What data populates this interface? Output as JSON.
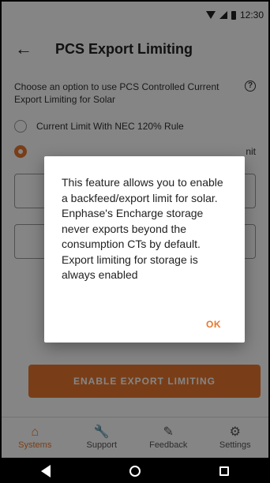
{
  "status": {
    "time": "12:30"
  },
  "appbar": {
    "title": "PCS Export Limiting"
  },
  "content": {
    "prompt": "Choose an option to use PCS Controlled Current Export Limiting for Solar",
    "options": [
      {
        "label": "Current Limit With NEC 120% Rule",
        "selected": false
      },
      {
        "label": "nit",
        "selected": true
      }
    ]
  },
  "primary_button": {
    "label": "ENABLE EXPORT LIMITING"
  },
  "nav": {
    "items": [
      {
        "label": "Systems",
        "icon": "home-icon",
        "active": true
      },
      {
        "label": "Support",
        "icon": "wrench-icon",
        "active": false
      },
      {
        "label": "Feedback",
        "icon": "feedback-icon",
        "active": false
      },
      {
        "label": "Settings",
        "icon": "gear-icon",
        "active": false
      }
    ]
  },
  "dialog": {
    "message": "This feature allows you to enable a backfeed/export limit for solar. Enphase's Encharge storage never exports beyond the consumption CTs by default. Export limiting for storage is always enabled",
    "ok_label": "OK"
  },
  "colors": {
    "accent": "#e8772e"
  }
}
